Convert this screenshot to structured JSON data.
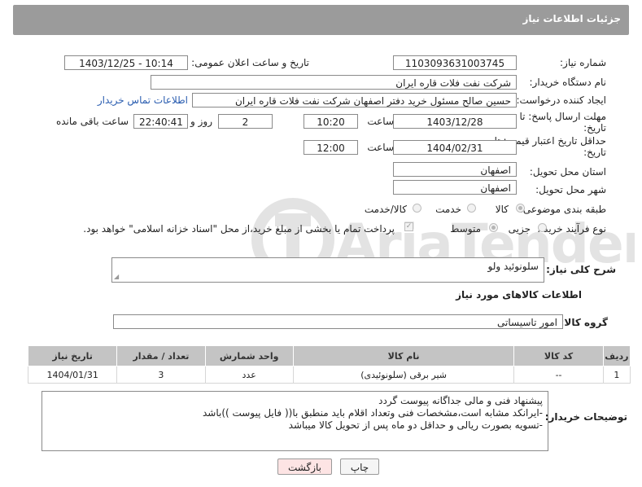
{
  "header": {
    "title": "جزئیات اطلاعات نیاز"
  },
  "form": {
    "need_number": {
      "label": "شماره نیاز:",
      "value": "1103093631003745"
    },
    "announce_datetime": {
      "label": "تاریخ و ساعت اعلان عمومی:",
      "value": "1403/12/25 - 10:14"
    },
    "buyer_org": {
      "label": "نام دستگاه خریدار:",
      "value": "شرکت نفت فلات قاره ایران"
    },
    "requester": {
      "label": "ایجاد کننده درخواست:",
      "value": "حسین  صالح مسئول خرید دفتر اصفهان شرکت نفت فلات قاره ایران",
      "contact_link": "اطلاعات تماس خریدار"
    },
    "reply_deadline": {
      "label_line1": "مهلت ارسال پاسخ: تا",
      "label_line2": "تاریخ:",
      "date": "1403/12/28",
      "time_label": "ساعت",
      "time": "10:20",
      "days": "2",
      "days_label": "روز و",
      "remaining_time": "22:40:41",
      "remaining_label": "ساعت باقی مانده"
    },
    "price_validity": {
      "label_line1": "حداقل تاریخ اعتبار قیمت: تا",
      "label_line2": "تاریخ:",
      "date": "1404/02/31",
      "time_label": "ساعت",
      "time": "12:00"
    },
    "delivery_province": {
      "label": "استان محل تحویل:",
      "value": "اصفهان"
    },
    "delivery_city": {
      "label": "شهر محل تحویل:",
      "value": "اصفهان"
    },
    "subject_category": {
      "label": "طبقه بندی موضوعی:",
      "options": [
        "کالا",
        "خدمت",
        "کالا/خدمت"
      ],
      "selected": "کالا"
    },
    "purchase_process": {
      "label": "نوع فرآیند خرید :",
      "options": [
        "جزیی",
        "متوسط"
      ],
      "selected": "متوسط",
      "note": "پرداخت تمام یا بخشی از مبلغ خرید،از محل \"اسناد خزانه اسلامی\" خواهد بود."
    }
  },
  "description": {
    "label": "شرح کلی نیاز:",
    "value": "سلونوئید ولو"
  },
  "goods_section": {
    "title": "اطلاعات کالاهای مورد نیاز"
  },
  "goods_group": {
    "label": "گروه کالا:",
    "value": "امور تاسیساتی"
  },
  "table": {
    "headers": [
      "ردیف",
      "کد کالا",
      "نام کالا",
      "واحد شمارش",
      "تعداد / مقدار",
      "تاریخ نیاز"
    ],
    "rows": [
      [
        "1",
        "--",
        "شیر برقی (سلونوئیدی)",
        "عدد",
        "3",
        "1404/01/31"
      ]
    ]
  },
  "buyer_notes": {
    "label": "توضیحات خریدار:",
    "lines": [
      "پیشنهاد فنی و مالی جداگانه پیوست گردد",
      "-ایرانکد مشابه است،مشخصات فنی وتعداد اقلام باید منطبق با(( فایل پیوست ))باشد",
      "-تسویه بصورت ریالی و حداقل دو ماه پس از تحویل کالا میباشد"
    ]
  },
  "buttons": {
    "print": "چاپ",
    "back": "بازگشت"
  },
  "watermark": {
    "text": "AriaTender.net"
  },
  "colors": {
    "header_bg": "#9b9b9b",
    "table_header_bg": "#c4c4c4",
    "link": "#2a5db0",
    "back_button_bg": "#fde4e4"
  }
}
